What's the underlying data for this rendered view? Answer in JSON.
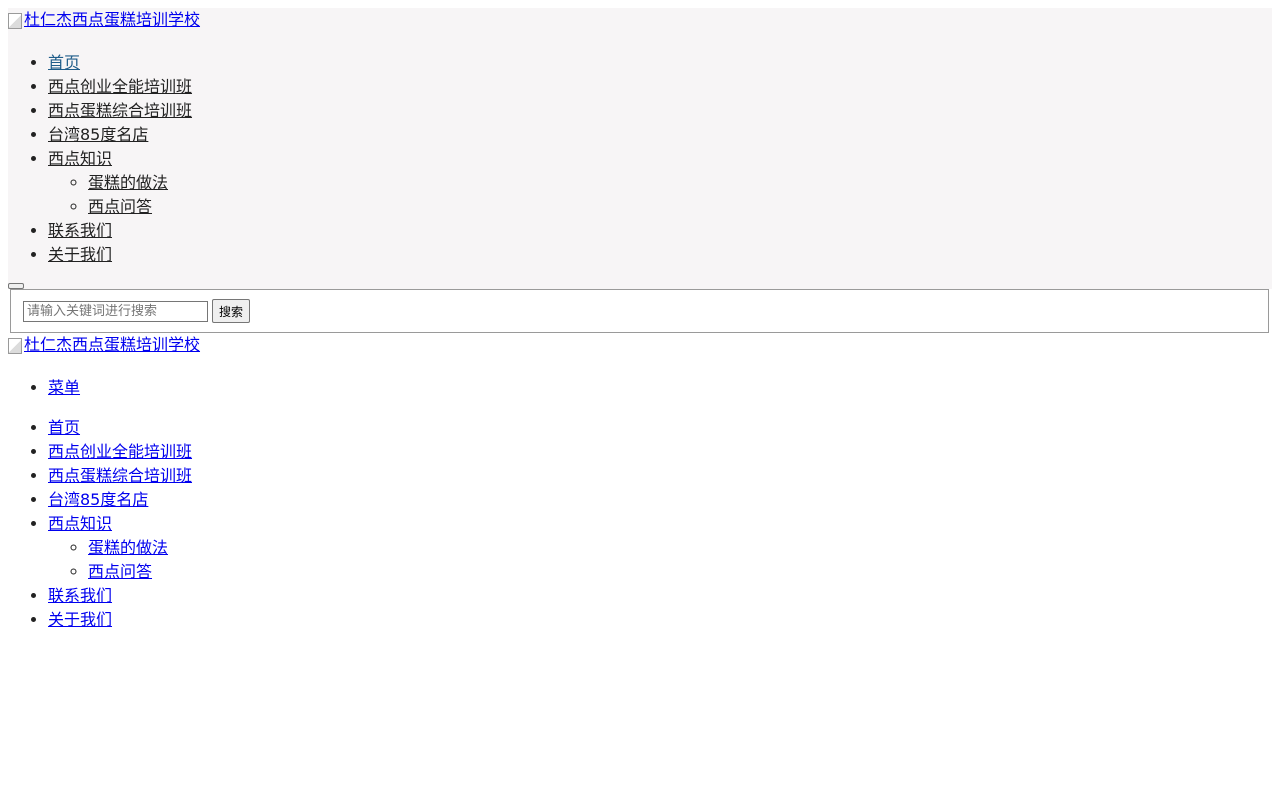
{
  "logo": {
    "alt": "杜仁杰西点蛋糕培训学校"
  },
  "nav": {
    "items": [
      {
        "label": "首页"
      },
      {
        "label": "西点创业全能培训班"
      },
      {
        "label": "西点蛋糕综合培训班"
      },
      {
        "label": "台湾85度名店"
      },
      {
        "label": "西点知识",
        "children": [
          {
            "label": "蛋糕的做法"
          },
          {
            "label": "西点问答"
          }
        ]
      },
      {
        "label": "联系我们"
      },
      {
        "label": "关于我们"
      }
    ]
  },
  "search": {
    "placeholder": "请输入关键词进行搜索",
    "value": "",
    "button_label": "搜索"
  },
  "mobile": {
    "logo_alt": "杜仁杰西点蛋糕培训学校",
    "menu_label": "菜单"
  },
  "colors": {
    "header_bg": "#f7f5f6",
    "link": "#0000ee",
    "current_link": "#1f5d8a"
  }
}
